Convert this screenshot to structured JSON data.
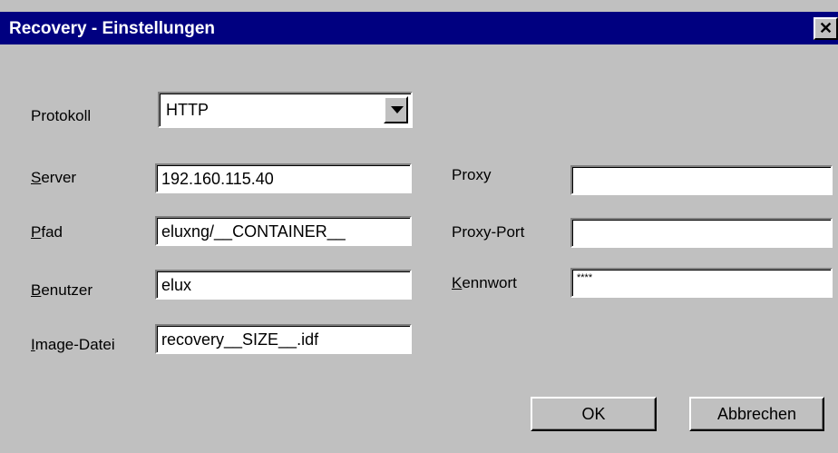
{
  "window": {
    "title": "Recovery - Einstellungen",
    "close_glyph": "✕"
  },
  "form": {
    "protokoll": {
      "label": "Protokoll",
      "value": "HTTP"
    },
    "server": {
      "label": "Server",
      "value": "192.160.115.40"
    },
    "pfad": {
      "label": "Pfad",
      "value": "eluxng/__CONTAINER__"
    },
    "benutzer": {
      "label": "Benutzer",
      "value": "elux"
    },
    "image_datei": {
      "label": "Image-Datei",
      "value": "recovery__SIZE__.idf"
    },
    "proxy": {
      "label": "Proxy",
      "value": ""
    },
    "proxy_port": {
      "label": "Proxy-Port",
      "value": ""
    },
    "kennwort": {
      "label": "Kennwort",
      "value": "****"
    }
  },
  "buttons": {
    "ok": "OK",
    "cancel": "Abbrechen"
  }
}
